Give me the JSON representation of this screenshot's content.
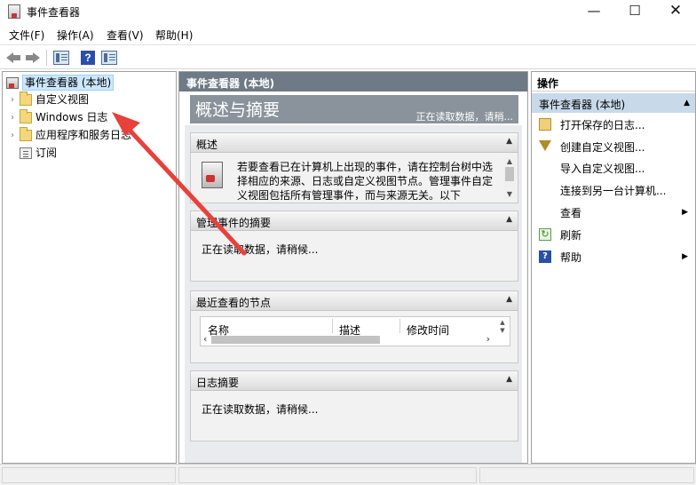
{
  "window": {
    "title": "事件查看器",
    "minimize": "—",
    "maximize": "☐",
    "close": "✕"
  },
  "menu": [
    "文件(F)",
    "操作(A)",
    "查看(V)",
    "帮助(H)"
  ],
  "toolbar": {
    "help_label": "?"
  },
  "tree": {
    "items": [
      {
        "label": "事件查看器 (本地)",
        "expander": ""
      },
      {
        "label": "自定义视图",
        "expander": "›"
      },
      {
        "label": "Windows 日志",
        "expander": "›"
      },
      {
        "label": "应用程序和服务日志",
        "expander": "›"
      },
      {
        "label": "订阅",
        "expander": ""
      }
    ]
  },
  "center": {
    "header": "事件查看器 (本地)",
    "overview_title": "概述与摘要",
    "overview_status": "正在读取数据，请稍...",
    "sections": {
      "overview": {
        "title": "概述",
        "text": "若要查看已在计算机上出现的事件，请在控制台树中选择相应的来源、日志或自定义视图节点。管理事件自定义视图包括所有管理事件，而与来源无关。以下"
      },
      "admin": {
        "title": "管理事件的摘要",
        "text": "正在读取数据，请稍候..."
      },
      "recent": {
        "title": "最近查看的节点",
        "columns": [
          "名称",
          "描述",
          "修改时间"
        ]
      },
      "logs": {
        "title": "日志摘要",
        "text": "正在读取数据，请稍候..."
      }
    }
  },
  "actions": {
    "header": "操作",
    "subheader": "事件查看器 (本地)",
    "items": [
      {
        "label": "打开保存的日志...",
        "icon": "open-log-icon",
        "submenu": ""
      },
      {
        "label": "创建自定义视图...",
        "icon": "filter-icon",
        "submenu": ""
      },
      {
        "label": "导入自定义视图...",
        "icon": "",
        "submenu": ""
      },
      {
        "label": "连接到另一台计算机...",
        "icon": "",
        "submenu": ""
      },
      {
        "label": "查看",
        "icon": "",
        "submenu": "▶"
      },
      {
        "label": "刷新",
        "icon": "refresh-icon",
        "submenu": ""
      },
      {
        "label": "帮助",
        "icon": "help-icon",
        "submenu": "▶"
      }
    ]
  },
  "colors": {
    "center_header": "#6e7a85",
    "actions_sub": "#c8d9ea",
    "annotation_arrow": "#e8403a"
  }
}
